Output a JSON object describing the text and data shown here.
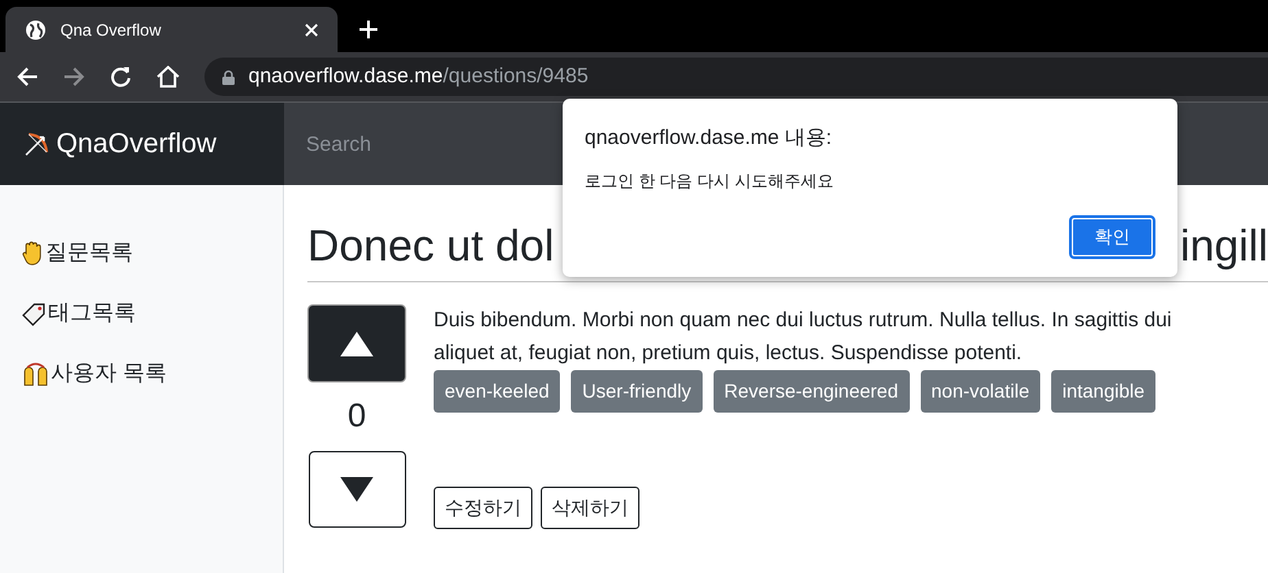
{
  "browser": {
    "tab": {
      "title": "Qna Overflow"
    },
    "url": {
      "host": "qnaoverflow.dase.me",
      "path": "/questions/9485"
    }
  },
  "navbar": {
    "brand": "QnaOverflow",
    "search": {
      "placeholder": "Search"
    }
  },
  "sidebar": {
    "items": [
      {
        "label": "질문목록",
        "kind": "hand"
      },
      {
        "label": "태그목록",
        "kind": "tag"
      },
      {
        "label": "사용자 목록",
        "kind": "people"
      }
    ]
  },
  "question": {
    "title_parts": [
      "Donec ut dol",
      "ingill"
    ],
    "votes": "0",
    "body_lines": [
      "Duis bibendum. Morbi non quam nec dui luctus rutrum. Nulla tellus. In sagittis dui",
      "aliquet at, feugiat non, pretium quis, lectus. Suspendisse potenti."
    ],
    "tags": [
      "even-keeled",
      "User-friendly",
      "Reverse-engineered",
      "non-volatile",
      "intangible"
    ],
    "actions": [
      "수정하기",
      "삭제하기"
    ]
  },
  "dialog": {
    "title": "qnaoverflow.dase.me 내용:",
    "message": "로그인 한 다음 다시 시도해주세요",
    "button": "확인"
  }
}
